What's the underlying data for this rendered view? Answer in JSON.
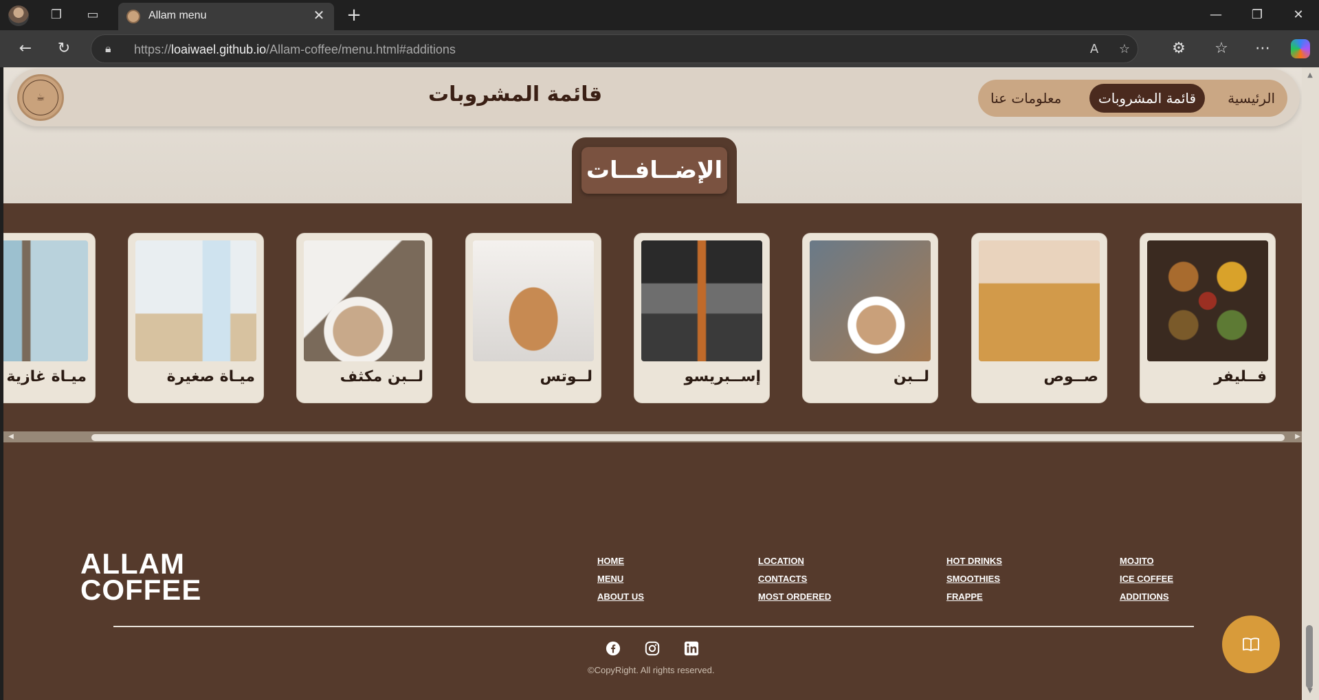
{
  "browser": {
    "tab_title": "Allam menu",
    "url_scheme": "https://",
    "url_host": "loaiwael.github.io",
    "url_path": "/Allam-coffee/menu.html#additions"
  },
  "header": {
    "page_title": "قائمة المشروبات",
    "nav": {
      "home": "الرئيسية",
      "menu": "قائمة المشروبات",
      "about": "معلومات عنا"
    }
  },
  "section": {
    "title": "الإضــافــات"
  },
  "cards": [
    {
      "label": "فــليفر",
      "image": "spices-photo"
    },
    {
      "label": "صــوص",
      "image": "caramel-sauce-photo"
    },
    {
      "label": "لــبن",
      "image": "milk-pour-photo"
    },
    {
      "label": "إســبريسو",
      "image": "espresso-shot-photo"
    },
    {
      "label": "لــوتس",
      "image": "lotus-spread-photo"
    },
    {
      "label": "لــبن مكثف",
      "image": "condensed-milk-photo"
    },
    {
      "label": "ميـاة صغيرة",
      "image": "small-water-bottle-photo"
    },
    {
      "label": "ميـاة غازية",
      "image": "sparkling-water-photo"
    }
  ],
  "footer": {
    "logo_line1": "ALLAM",
    "logo_line2": "COFFEE",
    "col1": [
      "HOME",
      "MENU",
      "ABOUT US"
    ],
    "col2": [
      "LOCATION",
      "CONTACTS",
      "MOST ORDERED"
    ],
    "col3": [
      "HOT DRINKS",
      "SMOOTHIES",
      "FRAPPE"
    ],
    "col4": [
      "MOJITO",
      "ICE COFFEE",
      "ADDITIONS"
    ],
    "copyright": "©CopyRight. All rights reserved.",
    "social": [
      "facebook-icon",
      "instagram-icon",
      "linkedin-icon"
    ]
  },
  "colors": {
    "brown_dark": "#553a2c",
    "nav_active": "#4a2a1e",
    "accent_gold": "#d89b3a",
    "beige": "#e3ddd3"
  }
}
